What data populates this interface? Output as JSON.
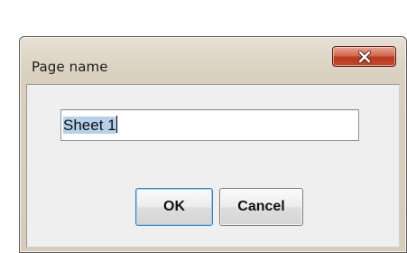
{
  "dialog": {
    "title": "Page name",
    "close_icon": "close-x-icon",
    "input": {
      "value": "Sheet 1"
    },
    "buttons": {
      "ok_label": "OK",
      "cancel_label": "Cancel"
    }
  },
  "colors": {
    "frame": "#d8cfbe",
    "client": "#efefef",
    "close_button": "#c2492f",
    "selection": "#b7d0ea",
    "default_button_border": "#3f7fb5"
  }
}
